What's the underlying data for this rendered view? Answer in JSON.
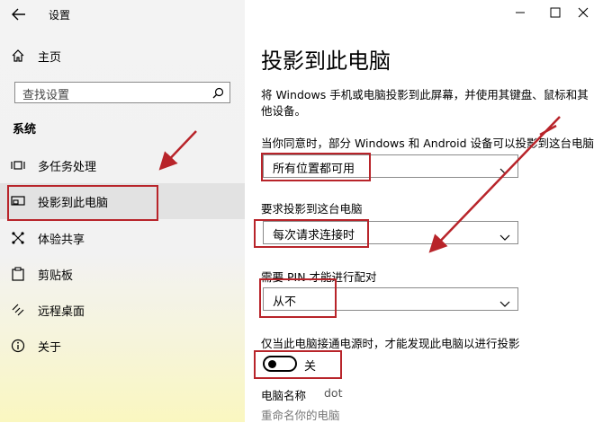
{
  "window": {
    "title": "设置",
    "controls": [
      "minimize-icon",
      "maximize-icon",
      "close-icon"
    ]
  },
  "sidebar": {
    "home_label": "主页",
    "search_placeholder": "查找设置",
    "section_title": "系统",
    "items": [
      {
        "label": "多任务处理",
        "icon": "multitasking-icon"
      },
      {
        "label": "投影到此电脑",
        "icon": "project-icon",
        "selected": true
      },
      {
        "label": "体验共享",
        "icon": "share-icon"
      },
      {
        "label": "剪贴板",
        "icon": "clipboard-icon"
      },
      {
        "label": "远程桌面",
        "icon": "remote-desktop-icon"
      },
      {
        "label": "关于",
        "icon": "info-icon"
      }
    ]
  },
  "main": {
    "title": "投影到此电脑",
    "description_line1": "将 Windows 手机或电脑投影到此屏幕，并使用其键盘、鼠标和其",
    "description_line2": "他设备。",
    "setting1": {
      "label": "当你同意时，部分 Windows 和 Android 设备可以投影到这台电脑",
      "value": "所有位置都可用"
    },
    "setting2": {
      "label": "要求投影到这台电脑",
      "value": "每次请求连接时"
    },
    "setting3": {
      "label": "需要 PIN 才能进行配对",
      "value": "从不"
    },
    "setting4": {
      "label": "仅当此电脑接通电源时，才能发现此电脑以进行投影",
      "toggle_state": "关",
      "toggle_on": false
    },
    "pc_name_label": "电脑名称",
    "pc_name_value": "dot",
    "rename_link": "重命名你的电脑"
  },
  "colors": {
    "annotation_red": "#b8242a",
    "sidebar_bg": "#f2f2f2",
    "selected_bg": "#e2e2e2"
  }
}
